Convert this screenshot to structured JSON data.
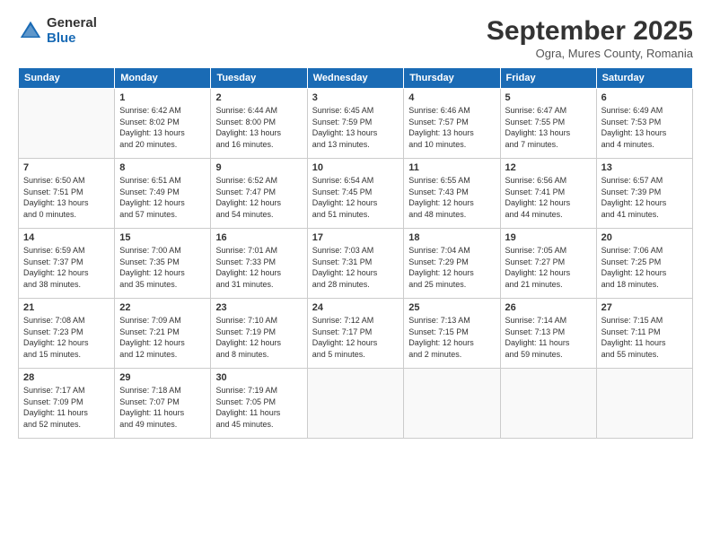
{
  "logo": {
    "general": "General",
    "blue": "Blue"
  },
  "title": "September 2025",
  "location": "Ogra, Mures County, Romania",
  "headers": [
    "Sunday",
    "Monday",
    "Tuesday",
    "Wednesday",
    "Thursday",
    "Friday",
    "Saturday"
  ],
  "weeks": [
    [
      {
        "day": "",
        "info": ""
      },
      {
        "day": "1",
        "info": "Sunrise: 6:42 AM\nSunset: 8:02 PM\nDaylight: 13 hours\nand 20 minutes."
      },
      {
        "day": "2",
        "info": "Sunrise: 6:44 AM\nSunset: 8:00 PM\nDaylight: 13 hours\nand 16 minutes."
      },
      {
        "day": "3",
        "info": "Sunrise: 6:45 AM\nSunset: 7:59 PM\nDaylight: 13 hours\nand 13 minutes."
      },
      {
        "day": "4",
        "info": "Sunrise: 6:46 AM\nSunset: 7:57 PM\nDaylight: 13 hours\nand 10 minutes."
      },
      {
        "day": "5",
        "info": "Sunrise: 6:47 AM\nSunset: 7:55 PM\nDaylight: 13 hours\nand 7 minutes."
      },
      {
        "day": "6",
        "info": "Sunrise: 6:49 AM\nSunset: 7:53 PM\nDaylight: 13 hours\nand 4 minutes."
      }
    ],
    [
      {
        "day": "7",
        "info": "Sunrise: 6:50 AM\nSunset: 7:51 PM\nDaylight: 13 hours\nand 0 minutes."
      },
      {
        "day": "8",
        "info": "Sunrise: 6:51 AM\nSunset: 7:49 PM\nDaylight: 12 hours\nand 57 minutes."
      },
      {
        "day": "9",
        "info": "Sunrise: 6:52 AM\nSunset: 7:47 PM\nDaylight: 12 hours\nand 54 minutes."
      },
      {
        "day": "10",
        "info": "Sunrise: 6:54 AM\nSunset: 7:45 PM\nDaylight: 12 hours\nand 51 minutes."
      },
      {
        "day": "11",
        "info": "Sunrise: 6:55 AM\nSunset: 7:43 PM\nDaylight: 12 hours\nand 48 minutes."
      },
      {
        "day": "12",
        "info": "Sunrise: 6:56 AM\nSunset: 7:41 PM\nDaylight: 12 hours\nand 44 minutes."
      },
      {
        "day": "13",
        "info": "Sunrise: 6:57 AM\nSunset: 7:39 PM\nDaylight: 12 hours\nand 41 minutes."
      }
    ],
    [
      {
        "day": "14",
        "info": "Sunrise: 6:59 AM\nSunset: 7:37 PM\nDaylight: 12 hours\nand 38 minutes."
      },
      {
        "day": "15",
        "info": "Sunrise: 7:00 AM\nSunset: 7:35 PM\nDaylight: 12 hours\nand 35 minutes."
      },
      {
        "day": "16",
        "info": "Sunrise: 7:01 AM\nSunset: 7:33 PM\nDaylight: 12 hours\nand 31 minutes."
      },
      {
        "day": "17",
        "info": "Sunrise: 7:03 AM\nSunset: 7:31 PM\nDaylight: 12 hours\nand 28 minutes."
      },
      {
        "day": "18",
        "info": "Sunrise: 7:04 AM\nSunset: 7:29 PM\nDaylight: 12 hours\nand 25 minutes."
      },
      {
        "day": "19",
        "info": "Sunrise: 7:05 AM\nSunset: 7:27 PM\nDaylight: 12 hours\nand 21 minutes."
      },
      {
        "day": "20",
        "info": "Sunrise: 7:06 AM\nSunset: 7:25 PM\nDaylight: 12 hours\nand 18 minutes."
      }
    ],
    [
      {
        "day": "21",
        "info": "Sunrise: 7:08 AM\nSunset: 7:23 PM\nDaylight: 12 hours\nand 15 minutes."
      },
      {
        "day": "22",
        "info": "Sunrise: 7:09 AM\nSunset: 7:21 PM\nDaylight: 12 hours\nand 12 minutes."
      },
      {
        "day": "23",
        "info": "Sunrise: 7:10 AM\nSunset: 7:19 PM\nDaylight: 12 hours\nand 8 minutes."
      },
      {
        "day": "24",
        "info": "Sunrise: 7:12 AM\nSunset: 7:17 PM\nDaylight: 12 hours\nand 5 minutes."
      },
      {
        "day": "25",
        "info": "Sunrise: 7:13 AM\nSunset: 7:15 PM\nDaylight: 12 hours\nand 2 minutes."
      },
      {
        "day": "26",
        "info": "Sunrise: 7:14 AM\nSunset: 7:13 PM\nDaylight: 11 hours\nand 59 minutes."
      },
      {
        "day": "27",
        "info": "Sunrise: 7:15 AM\nSunset: 7:11 PM\nDaylight: 11 hours\nand 55 minutes."
      }
    ],
    [
      {
        "day": "28",
        "info": "Sunrise: 7:17 AM\nSunset: 7:09 PM\nDaylight: 11 hours\nand 52 minutes."
      },
      {
        "day": "29",
        "info": "Sunrise: 7:18 AM\nSunset: 7:07 PM\nDaylight: 11 hours\nand 49 minutes."
      },
      {
        "day": "30",
        "info": "Sunrise: 7:19 AM\nSunset: 7:05 PM\nDaylight: 11 hours\nand 45 minutes."
      },
      {
        "day": "",
        "info": ""
      },
      {
        "day": "",
        "info": ""
      },
      {
        "day": "",
        "info": ""
      },
      {
        "day": "",
        "info": ""
      }
    ]
  ]
}
